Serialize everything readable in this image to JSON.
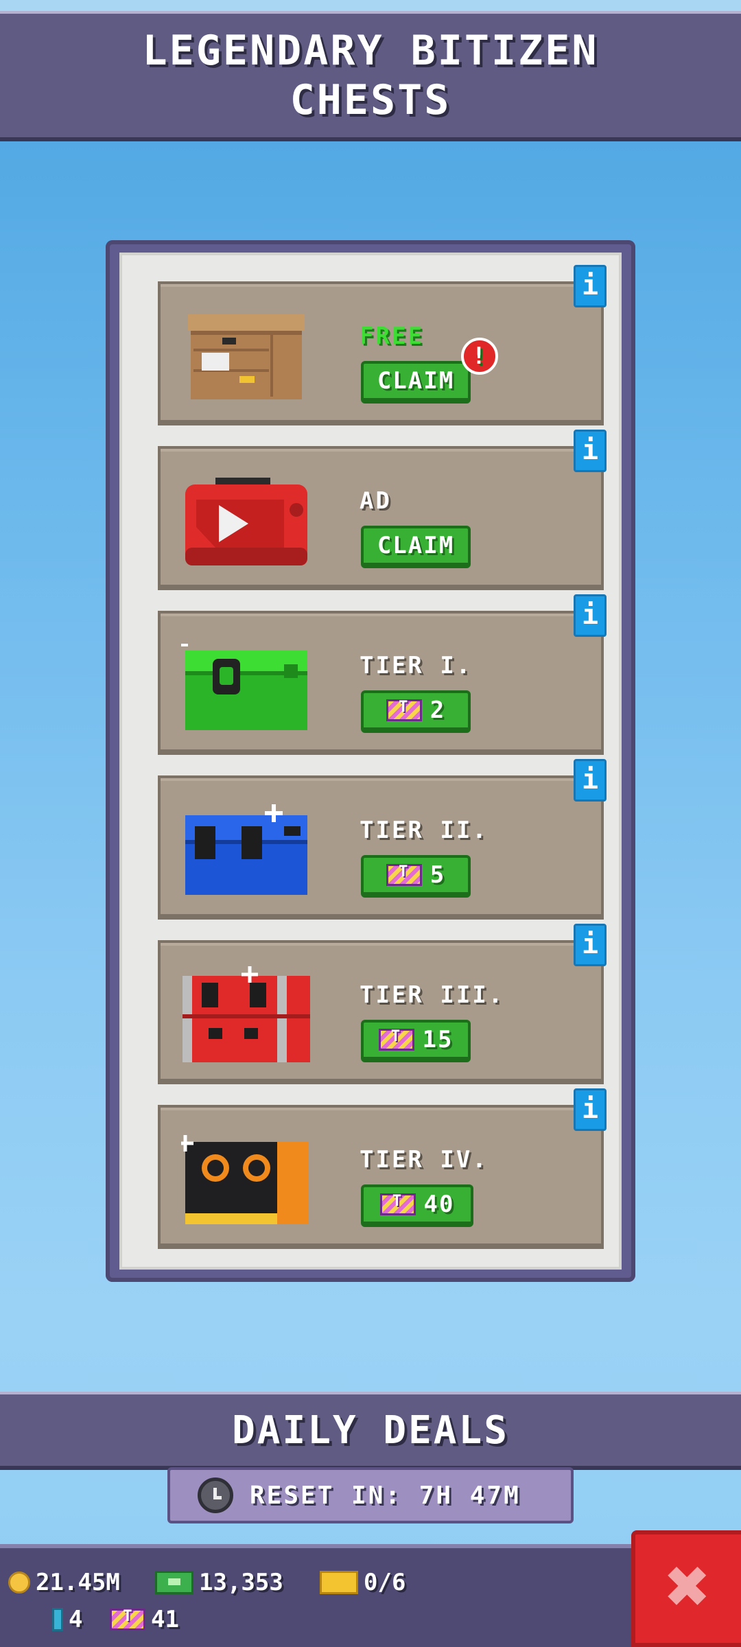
{
  "header": {
    "title": "LEGENDARY BITIZEN\nCHESTS"
  },
  "chests": [
    {
      "label": "FREE",
      "button": "CLAIM",
      "badge": "!",
      "info": "i",
      "color": "#b38659"
    },
    {
      "label": "AD",
      "button": "CLAIM",
      "info": "i",
      "color": "#e02b2b"
    },
    {
      "label": "TIER I.",
      "cost": "2",
      "info": "i",
      "color": "#2ec62b"
    },
    {
      "label": "TIER II.",
      "cost": "5",
      "info": "i",
      "color": "#1c55d6"
    },
    {
      "label": "TIER III.",
      "cost": "15",
      "info": "i",
      "color": "#e02a2a"
    },
    {
      "label": "TIER IV.",
      "cost": "40",
      "info": "i",
      "color": "#1f1f22"
    }
  ],
  "deals": {
    "title": "DAILY DEALS",
    "reset": "RESET IN: 7H 47M"
  },
  "resources": {
    "coins": "21.45M",
    "bux": "13,353",
    "vip": "0/6",
    "gems": "4",
    "tickets": "41"
  },
  "close": {
    "label": "✖"
  }
}
